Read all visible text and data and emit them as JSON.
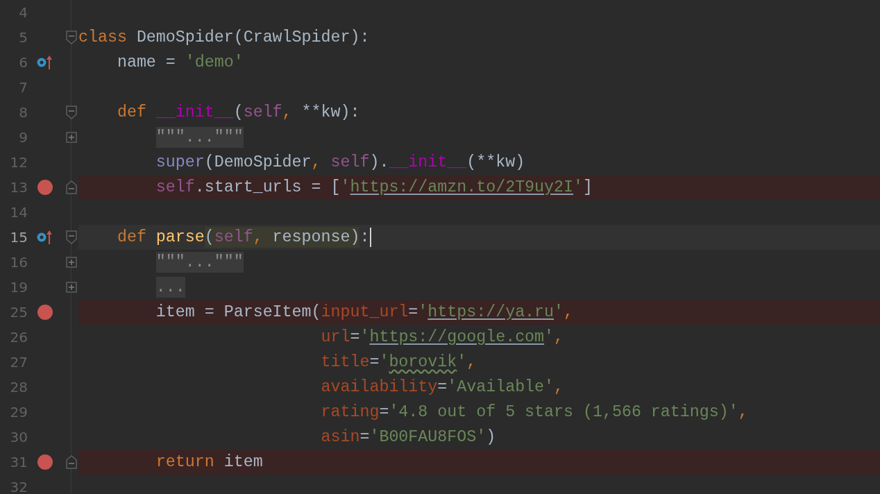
{
  "lines": [
    {
      "number": "4",
      "current": false
    },
    {
      "number": "5",
      "current": false,
      "fold": {
        "kind": "open"
      },
      "tokens": [
        {
          "kind": "keyword",
          "text": "class"
        },
        {
          "kind": "plain",
          "text": " DemoSpider(CrawlSpider):"
        }
      ]
    },
    {
      "number": "6",
      "current": false,
      "marker": {
        "kind": "override"
      },
      "tokens": [
        {
          "kind": "plain",
          "text": "    name = "
        },
        {
          "kind": "string",
          "text": "'demo'"
        }
      ]
    },
    {
      "number": "7",
      "current": false
    },
    {
      "number": "8",
      "current": false,
      "fold": {
        "kind": "open"
      },
      "tokens": [
        {
          "kind": "keyword",
          "text": "    def "
        },
        {
          "kind": "magic",
          "text": "__init__"
        },
        {
          "kind": "plain",
          "text": "("
        },
        {
          "kind": "self",
          "text": "self"
        },
        {
          "kind": "comma",
          "text": ","
        },
        {
          "kind": "plain",
          "text": " **kw):"
        }
      ]
    },
    {
      "number": "9",
      "current": false,
      "fold": {
        "kind": "collapsed"
      },
      "tokens": [
        {
          "kind": "folded",
          "text": "        \"\"\"...\"\"\""
        }
      ]
    },
    {
      "number": "12",
      "current": false,
      "tokens": [
        {
          "kind": "builtin",
          "text": "        super"
        },
        {
          "kind": "plain",
          "text": "(DemoSpider"
        },
        {
          "kind": "comma",
          "text": ","
        },
        {
          "kind": "self",
          "text": " self"
        },
        {
          "kind": "plain",
          "text": ")."
        },
        {
          "kind": "magic",
          "text": "__init__"
        },
        {
          "kind": "plain",
          "text": "(**kw)"
        }
      ]
    },
    {
      "number": "13",
      "current": false,
      "marker": {
        "kind": "breakpoint"
      },
      "fold": {
        "kind": "close"
      },
      "tokens": [
        {
          "kind": "self",
          "text": "        self"
        },
        {
          "kind": "plain",
          "text": ".start_urls = ["
        },
        {
          "kind": "string",
          "text": "'"
        },
        {
          "kind": "url",
          "text": "https://amzn.to/2T9uy2I"
        },
        {
          "kind": "string",
          "text": "'"
        },
        {
          "kind": "plain",
          "text": "]"
        }
      ]
    },
    {
      "number": "14",
      "current": false
    },
    {
      "number": "15",
      "current": true,
      "cursor": true,
      "marker": {
        "kind": "override"
      },
      "fold": {
        "kind": "open"
      },
      "tokens": [
        {
          "kind": "keyword",
          "text": "    def "
        },
        {
          "kind": "function",
          "text": "parse"
        },
        {
          "kind": "group",
          "tokens": [
            {
              "kind": "plain",
              "text": "("
            },
            {
              "kind": "self",
              "text": "self"
            },
            {
              "kind": "comma",
              "text": ","
            },
            {
              "kind": "plain",
              "text": " response)"
            }
          ]
        },
        {
          "kind": "plain",
          "text": ":"
        }
      ]
    },
    {
      "number": "16",
      "current": false,
      "fold": {
        "kind": "collapsed"
      },
      "tokens": [
        {
          "kind": "folded",
          "text": "        \"\"\"...\"\"\""
        }
      ]
    },
    {
      "number": "19",
      "current": false,
      "fold": {
        "kind": "collapsed"
      },
      "tokens": [
        {
          "kind": "folded",
          "text": "        ..."
        }
      ]
    },
    {
      "number": "25",
      "current": false,
      "marker": {
        "kind": "breakpoint"
      },
      "tokens": [
        {
          "kind": "plain",
          "text": "        item = ParseItem("
        },
        {
          "kind": "param",
          "text": "input_url"
        },
        {
          "kind": "plain",
          "text": "="
        },
        {
          "kind": "string",
          "text": "'"
        },
        {
          "kind": "url",
          "text": "https://ya.ru"
        },
        {
          "kind": "string",
          "text": "'"
        },
        {
          "kind": "comma",
          "text": ","
        }
      ]
    },
    {
      "number": "26",
      "current": false,
      "tokens": [
        {
          "kind": "param",
          "text": "                         url"
        },
        {
          "kind": "plain",
          "text": "="
        },
        {
          "kind": "string",
          "text": "'"
        },
        {
          "kind": "url",
          "text": "https://google.com"
        },
        {
          "kind": "string",
          "text": "'"
        },
        {
          "kind": "comma",
          "text": ","
        }
      ]
    },
    {
      "number": "27",
      "current": false,
      "tokens": [
        {
          "kind": "param",
          "text": "                         title"
        },
        {
          "kind": "plain",
          "text": "="
        },
        {
          "kind": "string",
          "text": "'"
        },
        {
          "kind": "typo",
          "text": "borovik"
        },
        {
          "kind": "string",
          "text": "'"
        },
        {
          "kind": "comma",
          "text": ","
        }
      ]
    },
    {
      "number": "28",
      "current": false,
      "tokens": [
        {
          "kind": "param",
          "text": "                         availability"
        },
        {
          "kind": "plain",
          "text": "="
        },
        {
          "kind": "string",
          "text": "'Available'"
        },
        {
          "kind": "comma",
          "text": ","
        }
      ]
    },
    {
      "number": "29",
      "current": false,
      "tokens": [
        {
          "kind": "param",
          "text": "                         rating"
        },
        {
          "kind": "plain",
          "text": "="
        },
        {
          "kind": "string",
          "text": "'4.8 out of 5 stars (1,566 ratings)'"
        },
        {
          "kind": "comma",
          "text": ","
        }
      ]
    },
    {
      "number": "30",
      "current": false,
      "tokens": [
        {
          "kind": "param",
          "text": "                         asin"
        },
        {
          "kind": "plain",
          "text": "="
        },
        {
          "kind": "string",
          "text": "'B00FAU8FOS'"
        },
        {
          "kind": "plain",
          "text": ")"
        }
      ]
    },
    {
      "number": "31",
      "current": false,
      "marker": {
        "kind": "breakpoint"
      },
      "fold": {
        "kind": "close"
      },
      "tokens": [
        {
          "kind": "keyword",
          "text": "        return"
        },
        {
          "kind": "plain",
          "text": " item"
        }
      ]
    },
    {
      "number": "32",
      "current": false
    }
  ]
}
